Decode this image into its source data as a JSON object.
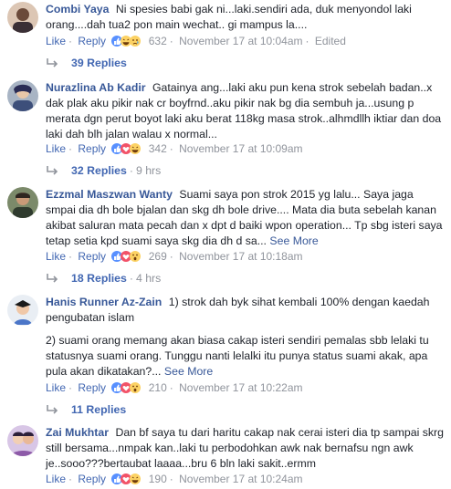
{
  "comments": [
    {
      "author": "Combi Yaya",
      "text": "Ni spesies babi gak ni...laki.sendiri ada, duk menyondol laki orang....dah tua2 pon main wechat.. gi mampus la....",
      "actions": {
        "like": "Like",
        "reply": "Reply",
        "reaction_count": "632",
        "time": "November 17 at 10:04am",
        "edited": "Edited"
      },
      "replies": "39 Replies",
      "reactions": [
        "like",
        "haha",
        "sad"
      ]
    },
    {
      "author": "Nurazlina Ab Kadir",
      "text": "Gatainya ang...laki aku pun kena strok sebelah badan..x dak plak aku pikir nak cr boyfrnd..aku pikir nak bg dia sembuh ja...usung p merata dgn perut boyot laki aku berat 118kg masa strok..alhmdllh iktiar dan doa laki dah blh jalan walau x normal...",
      "actions": {
        "like": "Like",
        "reply": "Reply",
        "reaction_count": "342",
        "time": "November 17 at 10:09am"
      },
      "replies": "32 Replies",
      "replies_time": "9 hrs",
      "reactions": [
        "like",
        "love",
        "haha"
      ]
    },
    {
      "author": "Ezzmal Maszwan Wanty",
      "text": "Suami saya pon strok 2015 yg lalu... Saya jaga smpai dia dh bole bjalan dan skg dh bole drive.... Mata dia buta sebelah kanan akibat saluran mata pecah dan x dpt d baiki wpon operation... Tp sbg isteri saya tetap setia kpd suami saya skg dia dh d sa...",
      "see_more": "See More",
      "actions": {
        "like": "Like",
        "reply": "Reply",
        "reaction_count": "269",
        "time": "November 17 at 10:18am"
      },
      "replies": "18 Replies",
      "replies_time": "4 hrs",
      "reactions": [
        "like",
        "love",
        "wow"
      ]
    },
    {
      "author": "Hanis Runner Az-Zain",
      "text": "1) strok dah byk sihat kembali 100% dengan kaedah pengubatan islam",
      "text2": "2) suami orang memang akan biasa cakap isteri sendiri pemalas sbb lelaki tu statusnya suami orang. Tunggu nanti lelalki itu punya status suami akak, apa pula akan dikatakan?...",
      "see_more": "See More",
      "actions": {
        "like": "Like",
        "reply": "Reply",
        "reaction_count": "210",
        "time": "November 17 at 10:22am"
      },
      "replies": "11 Replies",
      "reactions": [
        "like",
        "love",
        "wow"
      ]
    },
    {
      "author": "Zai Mukhtar",
      "text": "Dan bf saya tu dari haritu cakap nak cerai isteri dia tp sampai skrg still bersama...nmpak kan..laki tu perbodohkan awk nak bernafsu ngn awk je..sooo???bertaubat laaaa...bru 6 bln laki sakit..ermm",
      "actions": {
        "like": "Like",
        "reply": "Reply",
        "reaction_count": "190",
        "time": "November 17 at 10:24am"
      },
      "reactions": [
        "like",
        "love",
        "haha"
      ]
    }
  ],
  "colors": {
    "link": "#385898",
    "action": "#4267b2",
    "meta": "#90949c",
    "like": "#5890ff",
    "love": "#f25268",
    "emoji": "#fcd264"
  }
}
